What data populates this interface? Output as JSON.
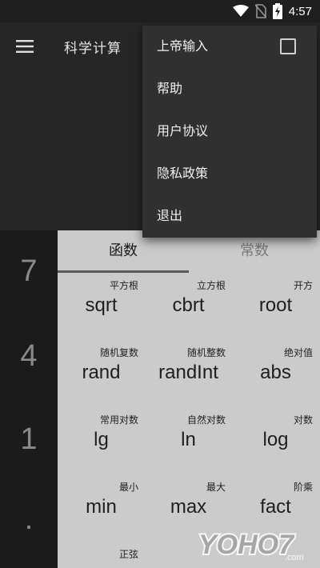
{
  "status_bar": {
    "time": "4:57",
    "icons": [
      "wifi-icon",
      "no-sim-icon",
      "battery-charging-icon"
    ]
  },
  "app_bar": {
    "title": "科学计算",
    "menu_icon": "hamburger-menu-icon"
  },
  "keypad": {
    "visible_keys": [
      "7",
      "4",
      "1",
      "."
    ]
  },
  "function_panel": {
    "tabs": [
      {
        "label": "函数",
        "active": true
      },
      {
        "label": "常数",
        "active": false
      }
    ],
    "functions": [
      {
        "label": "平方根",
        "name": "sqrt"
      },
      {
        "label": "立方根",
        "name": "cbrt"
      },
      {
        "label": "开方",
        "name": "root"
      },
      {
        "label": "随机复数",
        "name": "rand"
      },
      {
        "label": "随机整数",
        "name": "randInt"
      },
      {
        "label": "绝对值",
        "name": "abs"
      },
      {
        "label": "常用对数",
        "name": "lg"
      },
      {
        "label": "自然对数",
        "name": "ln"
      },
      {
        "label": "对数",
        "name": "log"
      },
      {
        "label": "最小",
        "name": "min"
      },
      {
        "label": "最大",
        "name": "max"
      },
      {
        "label": "阶乘",
        "name": "fact"
      },
      {
        "label": "正弦",
        "name": ""
      }
    ]
  },
  "overflow_menu": {
    "items": [
      {
        "label": "上帝输入",
        "checkbox": true,
        "checked": false
      },
      {
        "label": "帮助"
      },
      {
        "label": "用户协议"
      },
      {
        "label": "隐私政策"
      },
      {
        "label": "退出"
      }
    ]
  },
  "watermark": {
    "text": "YOHO7.com"
  },
  "colors": {
    "app_bar_bg": "#262626",
    "panel_bg": "#cbcbcb",
    "menu_bg": "#303030",
    "keypad_bg": "#1b1b1b"
  }
}
